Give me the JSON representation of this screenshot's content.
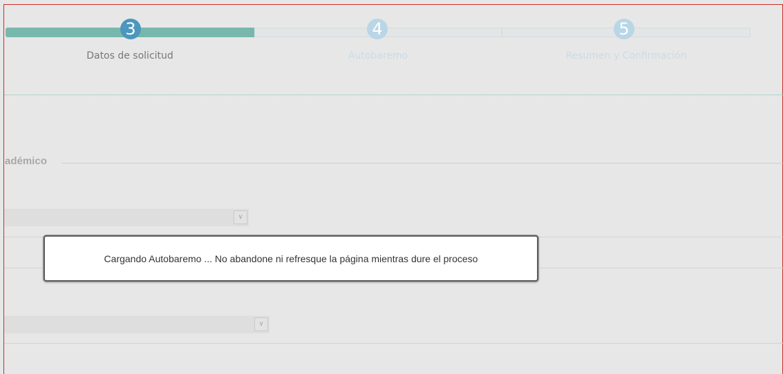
{
  "steps": [
    {
      "number": "3",
      "label": "Datos de solicitud",
      "state": "active"
    },
    {
      "number": "4",
      "label": "Autobaremo",
      "state": "pending"
    },
    {
      "number": "5",
      "label": "Resumen y Confirmación",
      "state": "pending"
    }
  ],
  "progress": {
    "completed_steps": 3,
    "of_visible": 5
  },
  "form": {
    "section_title": "adémico",
    "select_1_value": "",
    "select_2_value": ""
  },
  "dialog": {
    "message": "Cargando Autobaremo ... No abandone ni refresque la página mientras dure el proceso"
  },
  "colors": {
    "progress_fill": "#78b8ac",
    "active_step": "#4d96bd",
    "inactive_step": "#b9d6e6",
    "frame_border": "#cf2a2a"
  },
  "icons": {
    "select_arrow": "chevron-down-icon"
  }
}
